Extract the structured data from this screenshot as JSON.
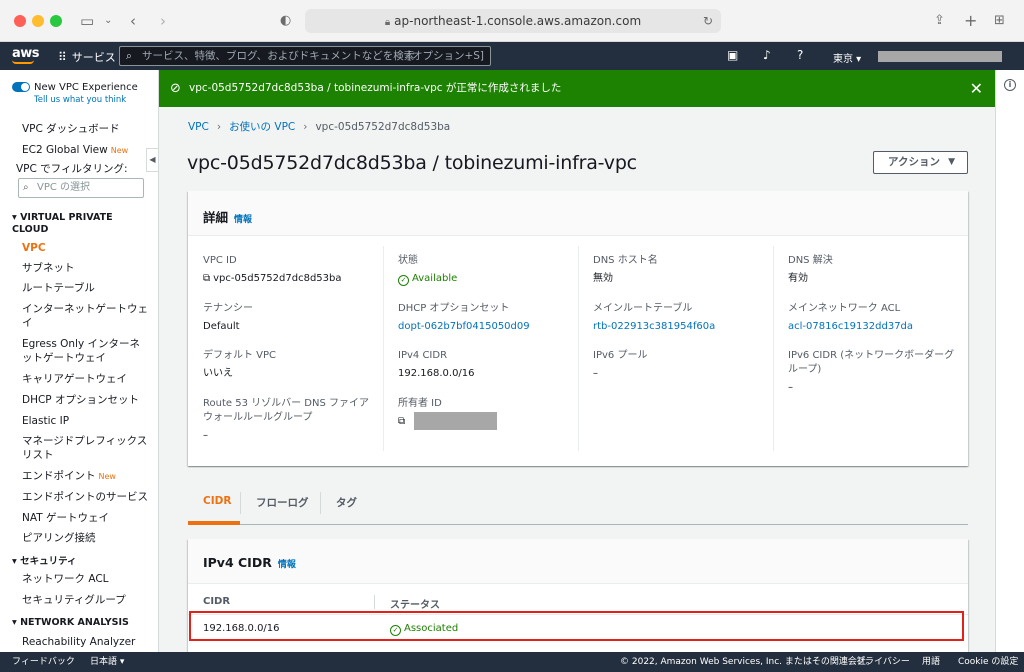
{
  "browser": {
    "url": "ap-northeast-1.console.aws.amazon.com"
  },
  "aws_nav": {
    "logo": "aws",
    "services": "サービス",
    "search_placeholder": "サービス、特徴、ブログ、およびドキュメントなどを検索",
    "search_shortcut": "[オプション+S]",
    "region": "東京 ▾"
  },
  "sidebar": {
    "toggle_label": "New VPC Experience",
    "toggle_sub": "Tell us what you think",
    "dashboard": "VPC ダッシュボード",
    "global_view": "EC2 Global View",
    "new_badge": "New",
    "filter_label": "VPC でフィルタリング:",
    "filter_placeholder": "VPC の選択",
    "section_vpc": "VIRTUAL PRIVATE CLOUD",
    "items": [
      "VPC",
      "サブネット",
      "ルートテーブル",
      "インターネットゲートウェイ",
      "Egress Only インターネットゲートウェイ",
      "キャリアゲートウェイ",
      "DHCP オプションセット",
      "Elastic IP",
      "マネージドプレフィックスリスト",
      "エンドポイント",
      "エンドポイントのサービス",
      "NAT ゲートウェイ",
      "ピアリング接続"
    ],
    "section_security": "セキュリティ",
    "security_items": [
      "ネットワーク ACL",
      "セキュリティグループ"
    ],
    "section_network": "NETWORK ANALYSIS",
    "network_items": [
      "Reachability Analyzer"
    ]
  },
  "flash": {
    "message": "vpc-05d5752d7dc8d53ba / tobinezumi-infra-vpc が正常に作成されました"
  },
  "breadcrumb": [
    "VPC",
    "お使いの VPC",
    "vpc-05d5752d7dc8d53ba"
  ],
  "page_title": "vpc-05d5752d7dc8d53ba / tobinezumi-infra-vpc",
  "actions_label": "アクション",
  "details": {
    "header": "詳細",
    "info": "情報",
    "vpc_id_label": "VPC ID",
    "vpc_id": "vpc-05d5752d7dc8d53ba",
    "state_label": "状態",
    "state": "Available",
    "dns_hostname_label": "DNS ホスト名",
    "dns_hostname": "無効",
    "dns_resolution_label": "DNS 解決",
    "dns_resolution": "有効",
    "tenancy_label": "テナンシー",
    "tenancy": "Default",
    "dhcp_label": "DHCP オプションセット",
    "dhcp": "dopt-062b7bf0415050d09",
    "main_rt_label": "メインルートテーブル",
    "main_rt": "rtb-022913c381954f60a",
    "main_acl_label": "メインネットワーク ACL",
    "main_acl": "acl-07816c19132dd37da",
    "default_vpc_label": "デフォルト VPC",
    "default_vpc": "いいえ",
    "ipv4_label": "IPv4 CIDR",
    "ipv4": "192.168.0.0/16",
    "ipv6_pool_label": "IPv6 プール",
    "ipv6_pool": "–",
    "ipv6_cidr_label": "IPv6 CIDR (ネットワークボーダーグループ)",
    "ipv6_cidr": "–",
    "resolver_label": "Route 53 リゾルバー DNS ファイアウォールルールグループ",
    "resolver": "–",
    "owner_label": "所有者 ID"
  },
  "tabs": [
    "CIDR",
    "フローログ",
    "タグ"
  ],
  "cidr_table": {
    "header": "IPv4 CIDR",
    "info": "情報",
    "columns": [
      "CIDR",
      "ステータス"
    ],
    "rows": [
      {
        "cidr": "192.168.0.0/16",
        "status": "Associated"
      }
    ]
  },
  "footer": {
    "feedback": "フィードバック",
    "language": "日本語 ▾",
    "copyright": "© 2022, Amazon Web Services, Inc. またはその関連会社。",
    "privacy": "プライバシー",
    "terms": "用語",
    "cookie": "Cookie の設定"
  },
  "colors": {
    "accent": "#ec7211",
    "link": "#0073bb",
    "success": "#1d8102",
    "nav": "#232f3e",
    "highlight": "#e0221b"
  }
}
